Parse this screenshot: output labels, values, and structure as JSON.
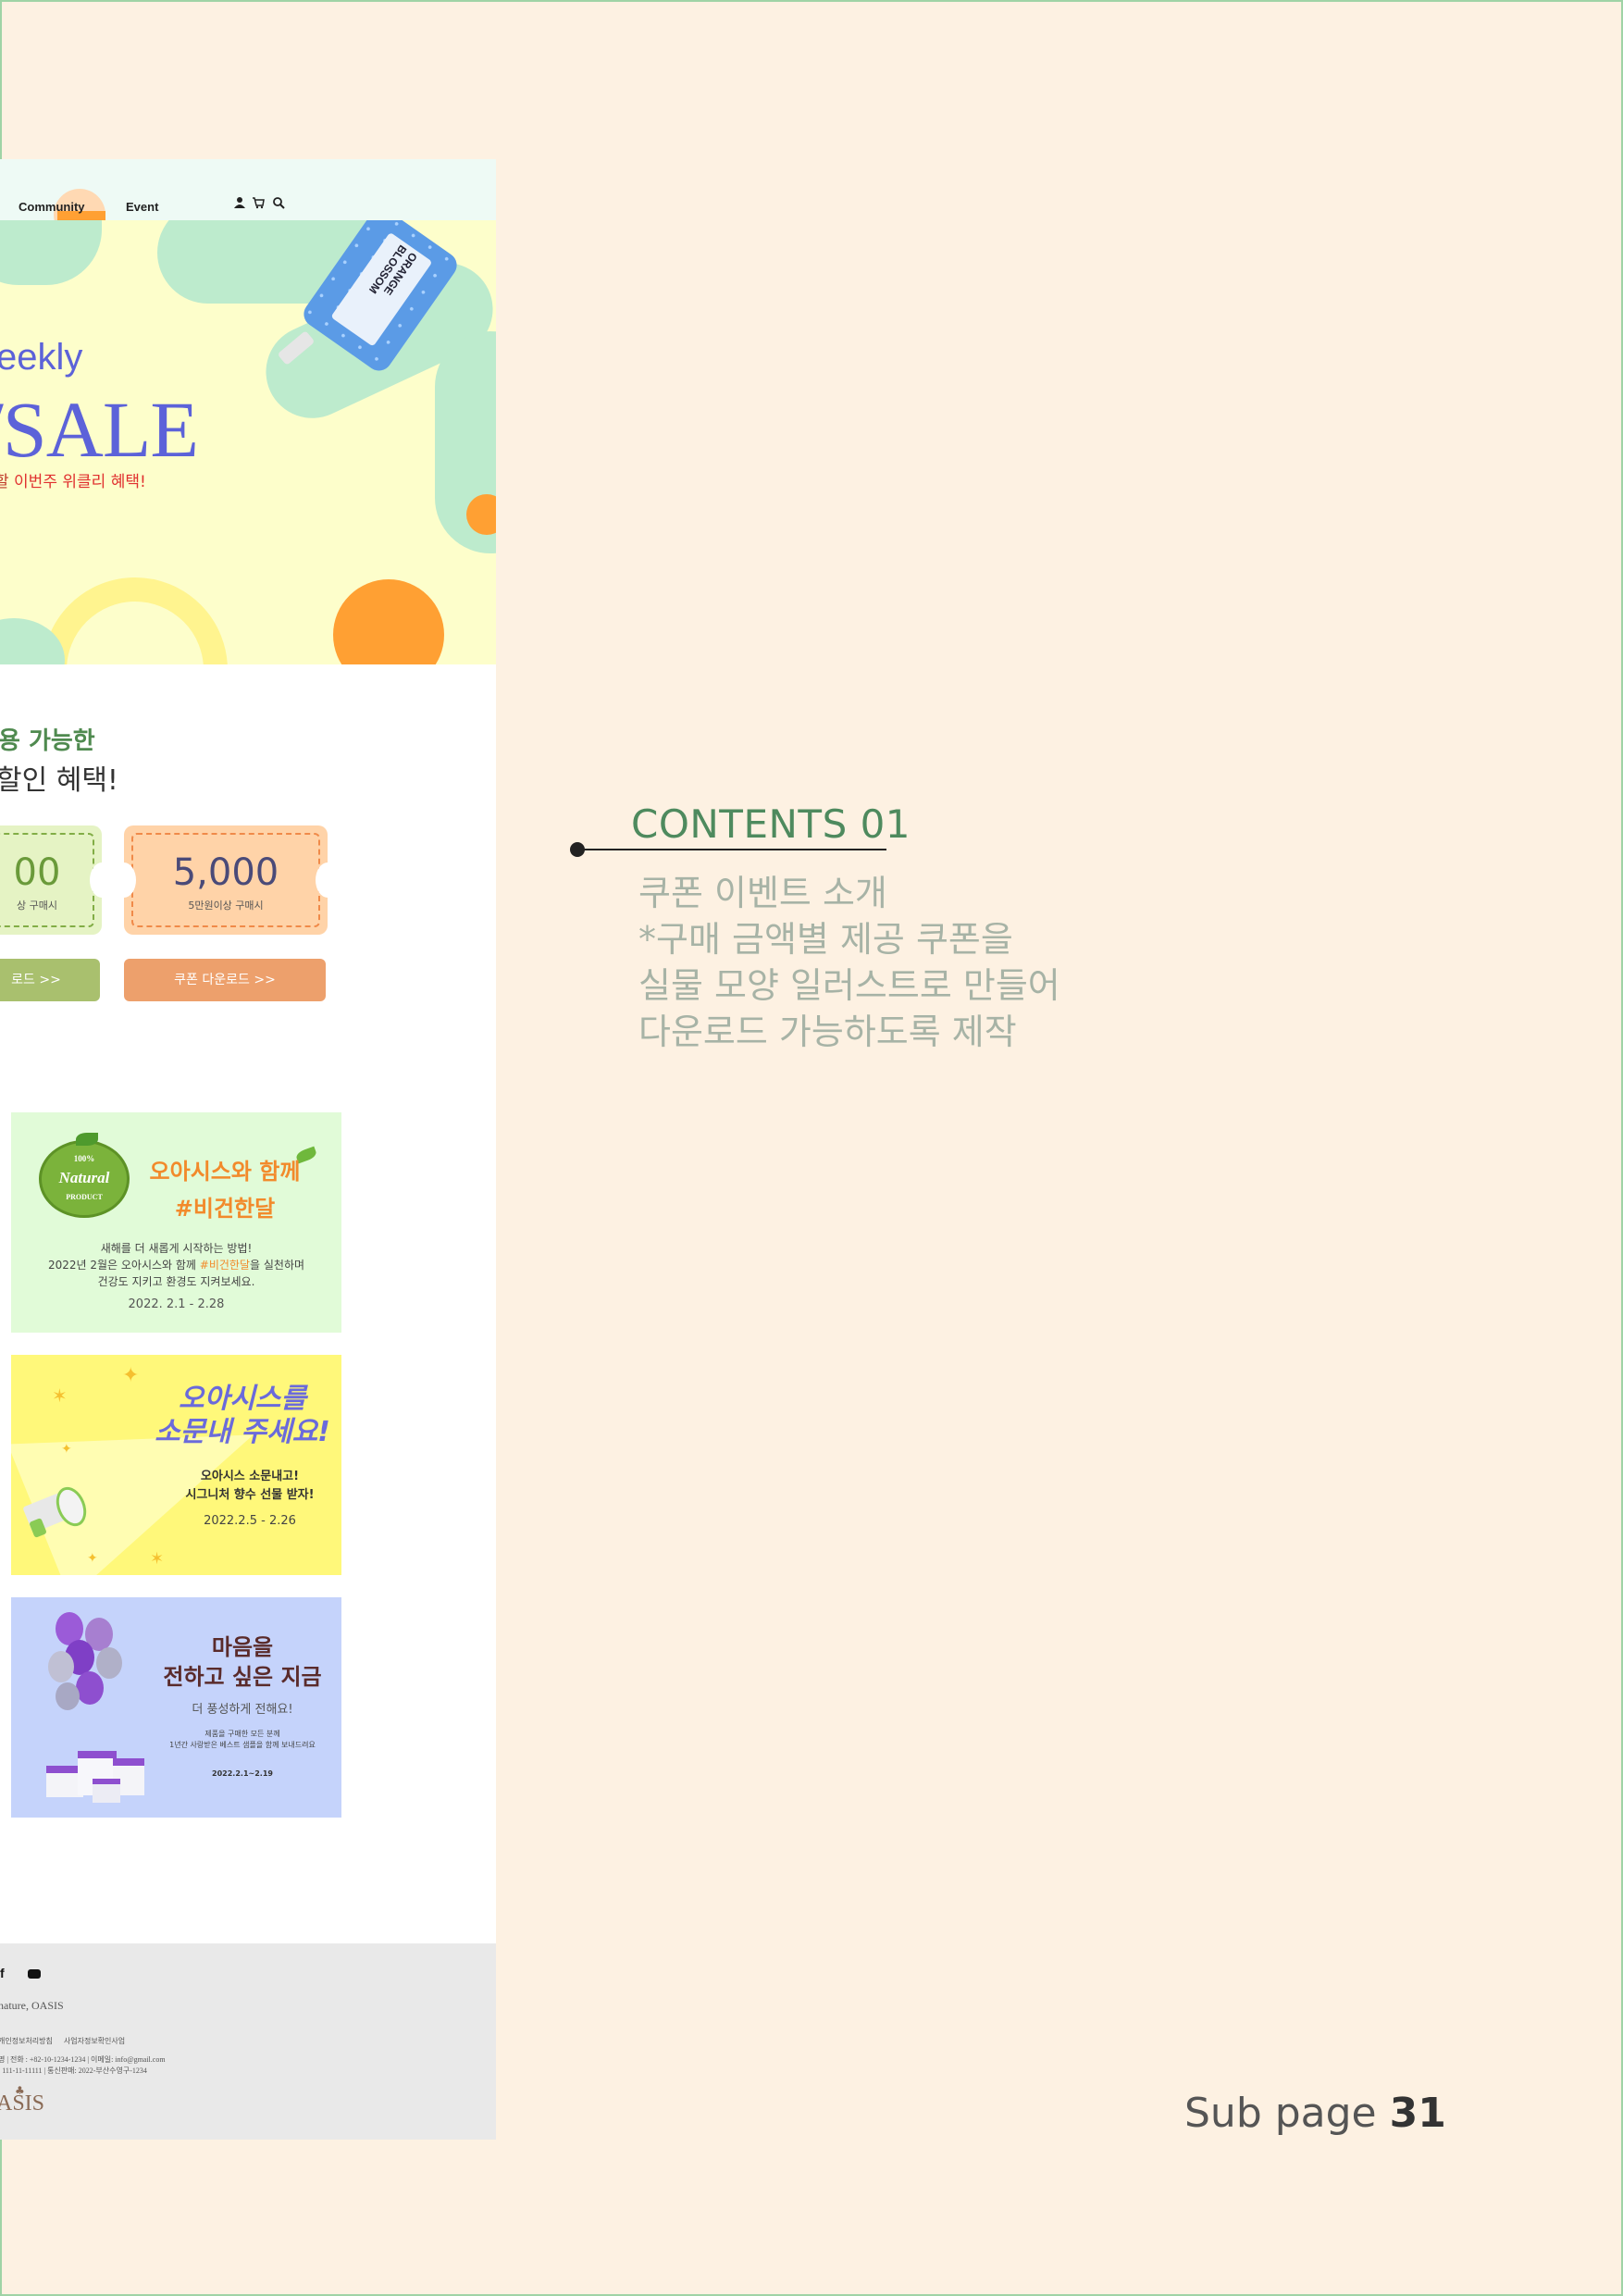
{
  "nav": {
    "community": "Community",
    "event": "Event"
  },
  "hero": {
    "bottle_text": "ORANGE BLOSSOM",
    "weekly": "eekly",
    "sale": "SALE",
    "sub_prefix": "할 ",
    "sub_red": "이번주 위클리 혜택!"
  },
  "coupons": {
    "heading1": "용 가능한",
    "heading2": "할인 혜택!",
    "first": {
      "amount": "00",
      "note": "상 구매시",
      "button": "로드  >>"
    },
    "second": {
      "amount": "5,000",
      "note": "5만원이상 구매시",
      "button": "쿠폰 다운로드  >>"
    }
  },
  "events": [
    {
      "badge_top": "100%",
      "badge_mid": "Natural",
      "badge_bot": "PRODUCT",
      "title1": "오아시스와 함께",
      "title2": "#비건한달",
      "line1": "새해를 더 새롭게 시작하는 방법!",
      "line2_a": "2022년 2월은 오아시스와 함께 ",
      "line2_b": "#비건한달",
      "line2_c": "을 실천하며",
      "line3": "건강도 지키고 환경도 지켜보세요.",
      "date": "2022. 2.1 - 2.28"
    },
    {
      "title1": "오아시스를",
      "title2": "소문내 주세요!",
      "line1": "오아시스 소문내고!",
      "line2": "시그니처 향수 선물 받자!",
      "date": "2022.2.5 - 2.26"
    },
    {
      "title1": "마음을",
      "title2": "전하고 싶은 지금",
      "line1": "더 풍성하게 전해요!",
      "line2": "제품을 구매한 모든 분께",
      "line3": "1년간 사랑받은 베스트 샘플을 함께 보내드려요",
      "date": "2022.2.1~2.19"
    }
  ],
  "footer": {
    "brand": "nature, OASIS",
    "links": "개인정보처리방침      사업자정보확인사업",
    "info1": "명 | 전화 : +82-10-1234-1234 | 이메일: info@gmail.com",
    "info2": ": 111-11-11111 | 통신판매: 2022-부산수영구-1234",
    "logo": "ASIS"
  },
  "annotation": {
    "title": "CONTENTS 01",
    "desc": "쿠폰 이벤트 소개\n*구매 금액별 제공 쿠폰을\n실물 모양 일러스트로 만들어\n다운로드 가능하도록 제작",
    "page_label": "Sub page ",
    "page_num": "31"
  },
  "colors": {
    "background": "#fdf1e2",
    "accent_green": "#4e8a5e",
    "sale_blue": "#5c62d9",
    "coupon_green_btn": "#a9c06e",
    "coupon_orange_btn": "#eda06c"
  }
}
